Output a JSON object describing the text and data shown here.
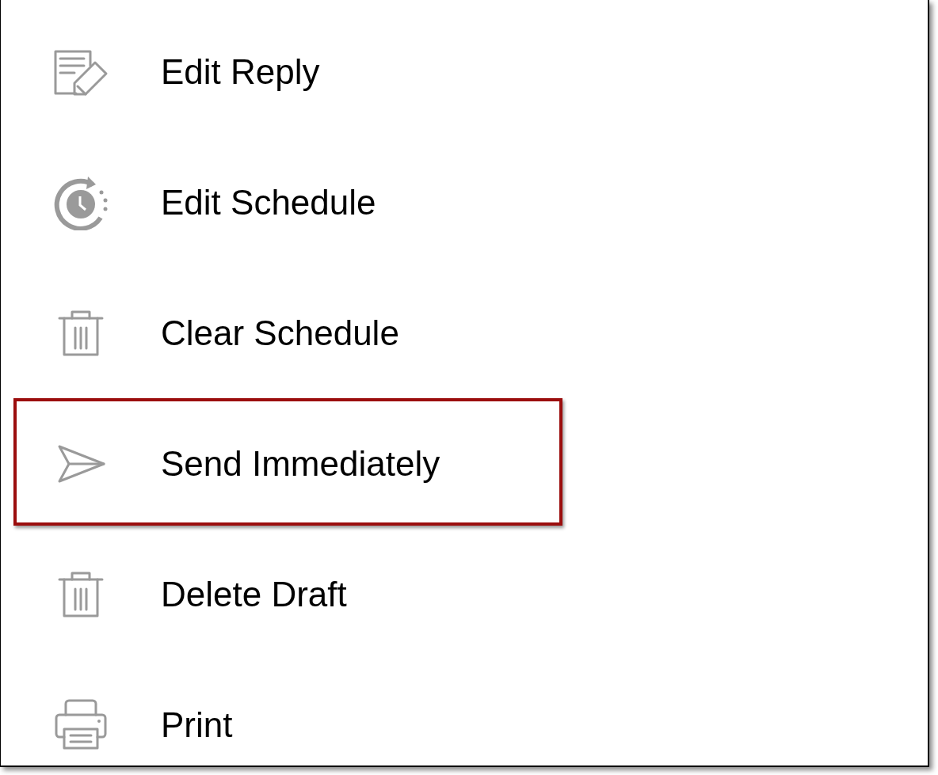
{
  "menu": {
    "items": [
      {
        "kind": "edit",
        "label": "Edit Reply",
        "highlighted": false
      },
      {
        "kind": "schedule",
        "label": "Edit Schedule",
        "highlighted": false
      },
      {
        "kind": "trash",
        "label": "Clear Schedule",
        "highlighted": false
      },
      {
        "kind": "send",
        "label": "Send Immediately",
        "highlighted": true
      },
      {
        "kind": "trash",
        "label": "Delete Draft",
        "highlighted": false
      },
      {
        "kind": "print",
        "label": "Print",
        "highlighted": false
      }
    ]
  }
}
